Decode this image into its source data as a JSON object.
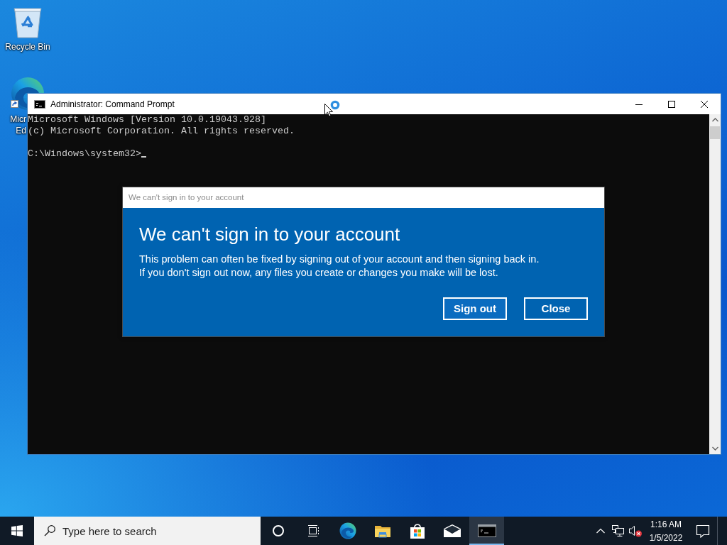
{
  "desktop": {
    "icons": [
      {
        "kind": "recycle-bin",
        "shortcut": false,
        "label_lines": [
          "Recycle Bin"
        ]
      },
      {
        "kind": "edge",
        "shortcut": true,
        "label_lines": [
          "Micr",
          "Ed"
        ]
      }
    ]
  },
  "console_window": {
    "title": "Administrator: Command Prompt",
    "banner": [
      "Microsoft Windows [Version 10.0.19043.928]",
      "(c) Microsoft Corporation. All rights reserved."
    ],
    "prompt": "C:\\Windows\\system32>",
    "cursor_visible": true
  },
  "pointer": {
    "busy": true
  },
  "dialog": {
    "title": "We can't sign in to your account",
    "heading": "We can't sign in to your account",
    "message": [
      "This problem can often be fixed by signing out of your account and then signing back in.",
      "If you don't sign out now, any files you create or changes you make will be lost."
    ],
    "buttons": [
      {
        "label": "Sign out"
      },
      {
        "label": "Close"
      }
    ]
  },
  "taskbar": {
    "search": {
      "placeholder": "Type here to search"
    },
    "apps": [
      {
        "kind": "cortana",
        "active": false
      },
      {
        "kind": "task-view",
        "active": false
      },
      {
        "kind": "edge",
        "active": false
      },
      {
        "kind": "file-explorer",
        "active": false
      },
      {
        "kind": "store",
        "active": false
      },
      {
        "kind": "mail",
        "active": false
      },
      {
        "kind": "command-prompt",
        "active": true
      }
    ],
    "tray": {
      "volume_muted": true
    },
    "clock": {
      "time": "1:16 AM",
      "date": "1/5/2022"
    }
  }
}
